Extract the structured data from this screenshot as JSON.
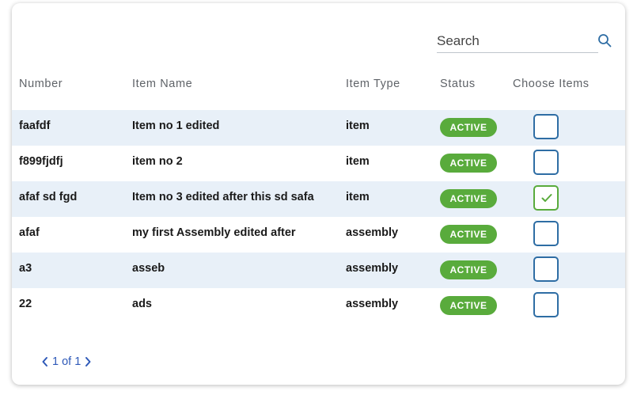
{
  "search": {
    "placeholder": "Search"
  },
  "table": {
    "headers": {
      "number": "Number",
      "item_name": "Item Name",
      "item_type": "Item Type",
      "status": "Status",
      "choose": "Choose Items"
    },
    "rows": [
      {
        "number": "faafdf",
        "name": "Item no 1 edited",
        "type": "item",
        "status": "ACTIVE",
        "selected": false
      },
      {
        "number": "f899fjdfj",
        "name": "item no 2",
        "type": "item",
        "status": "ACTIVE",
        "selected": false
      },
      {
        "number": "afaf sd fgd",
        "name": "Item no 3 edited after this sd safa",
        "type": "item",
        "status": "ACTIVE",
        "selected": true
      },
      {
        "number": "afaf",
        "name": "my first Assembly edited after",
        "type": "assembly",
        "status": "ACTIVE",
        "selected": false
      },
      {
        "number": "a3",
        "name": "asseb",
        "type": "assembly",
        "status": "ACTIVE",
        "selected": false
      },
      {
        "number": "22",
        "name": "ads",
        "type": "assembly",
        "status": "ACTIVE",
        "selected": false
      }
    ]
  },
  "pagination": {
    "label": "1 of 1"
  },
  "colors": {
    "accent": "#2e6da4",
    "status_active": "#59ab3c",
    "row_stripe": "#e8f0f8",
    "link": "#2e59b8"
  },
  "icons": {
    "search": "search-icon",
    "prev": "chevron-left-icon",
    "next": "chevron-right-icon",
    "check": "check-icon"
  }
}
